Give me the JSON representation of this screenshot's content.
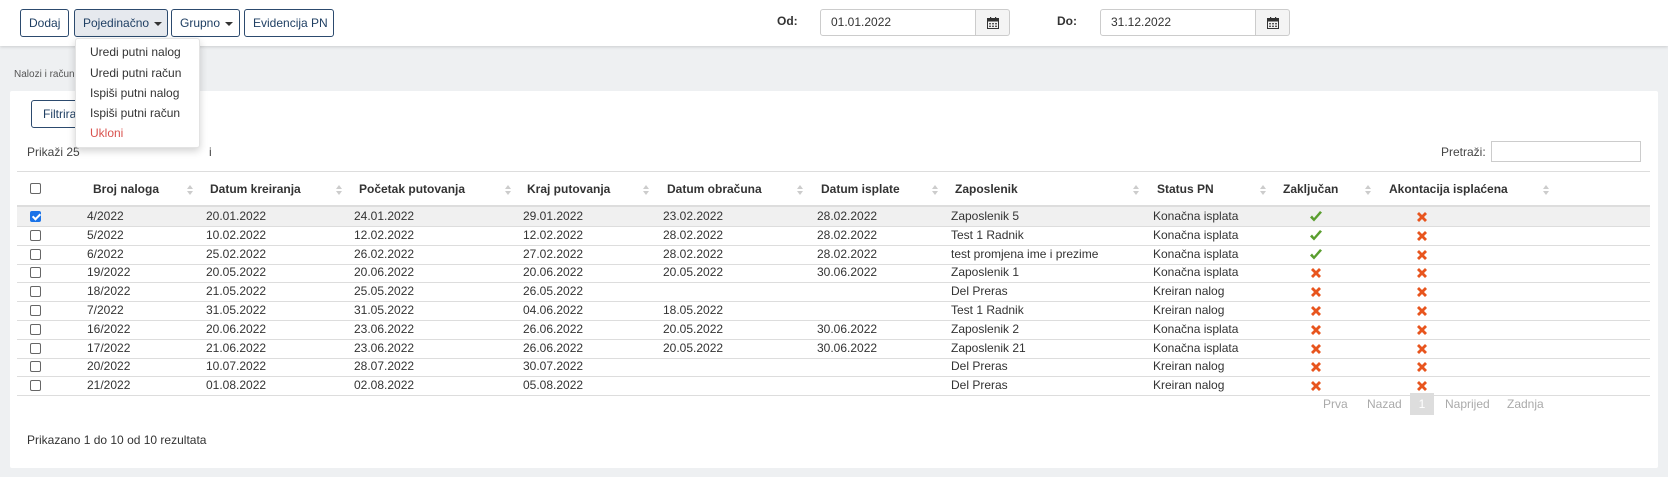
{
  "toolbar": {
    "add_label": "Dodaj",
    "single_label": "Pojedinačno",
    "group_label": "Grupno",
    "records_label": "Evidencija PN",
    "from_label": "Od:",
    "from_value": "01.01.2022",
    "to_label": "Do:",
    "to_value": "31.12.2022"
  },
  "breadcrumb": "Nalozi i računi",
  "dropdown": {
    "items": [
      "Uredi putni nalog",
      "Uredi putni račun",
      "Ispiši putni nalog",
      "Ispiši putni račun",
      "Ukloni"
    ]
  },
  "panel": {
    "filter_label": "Filtriraj",
    "show_prefix": "Prikaži",
    "show_value": "25",
    "show_suffix": "i",
    "search_label": "Pretraži:",
    "footer": "Prikazano 1 do 10 od 10 rezultata"
  },
  "table": {
    "headers": [
      "Broj naloga",
      "Datum kreiranja",
      "Početak putovanja",
      "Kraj putovanja",
      "Datum obračuna",
      "Datum isplate",
      "Zaposlenik",
      "Status PN",
      "Zaključan",
      "Akontacija isplaćena"
    ],
    "rows": [
      {
        "selected": true,
        "cells": [
          "4/2022",
          "20.01.2022",
          "24.01.2022",
          "29.01.2022",
          "23.02.2022",
          "28.02.2022",
          "Zaposlenik 5",
          "Konačna isplata"
        ],
        "locked": true,
        "advance_paid": false
      },
      {
        "selected": false,
        "cells": [
          "5/2022",
          "10.02.2022",
          "12.02.2022",
          "12.02.2022",
          "28.02.2022",
          "28.02.2022",
          "Test 1 Radnik",
          "Konačna isplata"
        ],
        "locked": true,
        "advance_paid": false
      },
      {
        "selected": false,
        "cells": [
          "6/2022",
          "25.02.2022",
          "26.02.2022",
          "27.02.2022",
          "28.02.2022",
          "28.02.2022",
          "test promjena ime i prezime",
          "Konačna isplata"
        ],
        "locked": true,
        "advance_paid": false
      },
      {
        "selected": false,
        "cells": [
          "19/2022",
          "20.05.2022",
          "20.06.2022",
          "20.06.2022",
          "20.05.2022",
          "30.06.2022",
          "Zaposlenik 1",
          "Konačna isplata"
        ],
        "locked": false,
        "advance_paid": false
      },
      {
        "selected": false,
        "cells": [
          "18/2022",
          "21.05.2022",
          "25.05.2022",
          "26.05.2022",
          "",
          "",
          "Del Preras",
          "Kreiran nalog"
        ],
        "locked": false,
        "advance_paid": false
      },
      {
        "selected": false,
        "cells": [
          "7/2022",
          "31.05.2022",
          "31.05.2022",
          "04.06.2022",
          "18.05.2022",
          "",
          "Test 1 Radnik",
          "Kreiran nalog"
        ],
        "locked": false,
        "advance_paid": false
      },
      {
        "selected": false,
        "cells": [
          "16/2022",
          "20.06.2022",
          "23.06.2022",
          "26.06.2022",
          "20.05.2022",
          "30.06.2022",
          "Zaposlenik 2",
          "Konačna isplata"
        ],
        "locked": false,
        "advance_paid": false
      },
      {
        "selected": false,
        "cells": [
          "17/2022",
          "21.06.2022",
          "23.06.2022",
          "26.06.2022",
          "20.05.2022",
          "30.06.2022",
          "Zaposlenik 21",
          "Konačna isplata"
        ],
        "locked": false,
        "advance_paid": false
      },
      {
        "selected": false,
        "cells": [
          "20/2022",
          "10.07.2022",
          "28.07.2022",
          "30.07.2022",
          "",
          "",
          "Del Preras",
          "Kreiran nalog"
        ],
        "locked": false,
        "advance_paid": false
      },
      {
        "selected": false,
        "cells": [
          "21/2022",
          "01.08.2022",
          "02.08.2022",
          "05.08.2022",
          "",
          "",
          "Del Preras",
          "Kreiran nalog"
        ],
        "locked": false,
        "advance_paid": false
      }
    ]
  },
  "pagination": {
    "first": "Prva",
    "prev": "Nazad",
    "current": "1",
    "next": "Naprijed",
    "last": "Zadnja"
  },
  "icons": {
    "check": "checkmark-icon",
    "cross": "cross-icon",
    "calendar": "calendar-icon"
  },
  "colors": {
    "check_green": "#5a9e2f",
    "cross_orange": "#e8551e",
    "primary_border": "#2c4a6e",
    "danger": "#d9534f"
  }
}
